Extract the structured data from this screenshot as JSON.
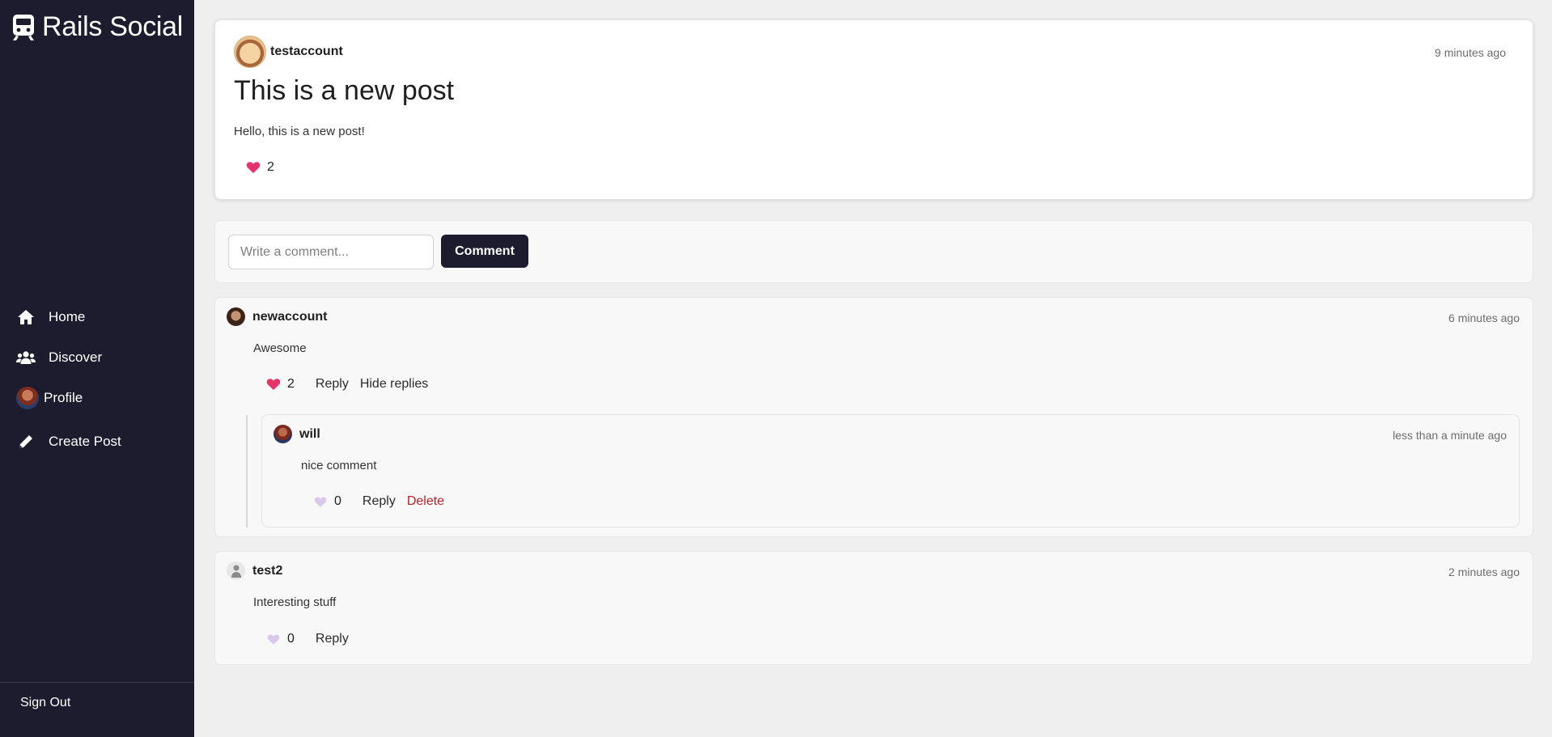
{
  "sidebar": {
    "brand": "Rails Social",
    "nav": [
      {
        "label": "Home",
        "icon": "home-icon"
      },
      {
        "label": "Discover",
        "icon": "users-icon"
      },
      {
        "label": "Profile",
        "icon": "avatar"
      },
      {
        "label": "Create Post",
        "icon": "pencil-icon"
      }
    ],
    "sign_out": "Sign Out"
  },
  "post": {
    "author": "testaccount",
    "time": "9 minutes ago",
    "title": "This is a new post",
    "body": "Hello, this is a new post!",
    "likes": "2"
  },
  "comment_form": {
    "placeholder": "Write a comment...",
    "button": "Comment"
  },
  "comments": [
    {
      "author": "newaccount",
      "time": "6 minutes ago",
      "body": "Awesome",
      "likes": "2",
      "reply_label": "Reply",
      "hide_replies_label": "Hide replies",
      "replies": [
        {
          "author": "will",
          "time": "less than a minute ago",
          "body": "nice comment",
          "likes": "0",
          "reply_label": "Reply",
          "delete_label": "Delete"
        }
      ]
    },
    {
      "author": "test2",
      "time": "2 minutes ago",
      "body": "Interesting stuff",
      "likes": "0",
      "reply_label": "Reply"
    }
  ],
  "colors": {
    "sidebar_bg": "#1d1c2e",
    "liked_heart": "#e8336a",
    "unliked_heart": "#d8c8ea",
    "delete": "#c0202a"
  }
}
